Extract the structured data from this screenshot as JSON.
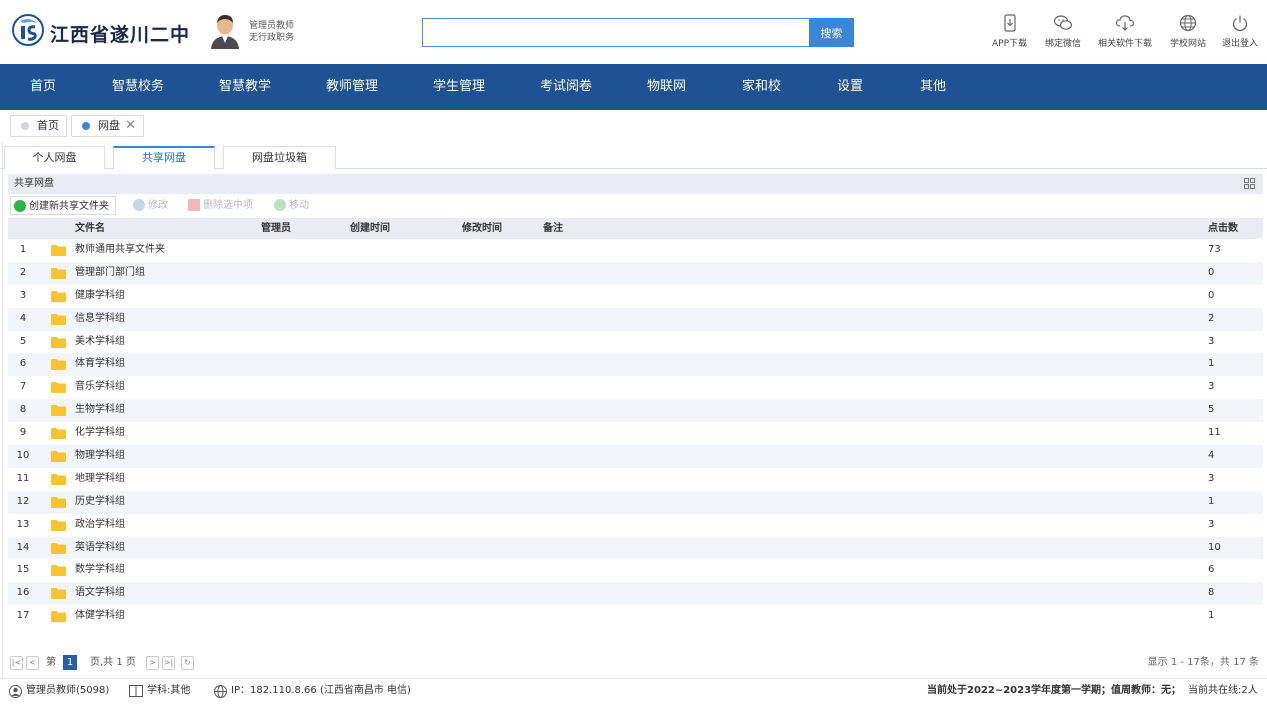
{
  "header": {
    "school_name": "江西省遂川二中",
    "user_role": "管理员教师",
    "user_dept": "无行政职务",
    "search_placeholder": "",
    "search_label": "搜索",
    "tools": [
      {
        "label": "APP下载",
        "icon": "phone-download-icon"
      },
      {
        "label": "绑定微信",
        "icon": "wechat-icon"
      },
      {
        "label": "相关软件下载",
        "icon": "cloud-download-icon"
      },
      {
        "label": "学校网站",
        "icon": "globe-icon"
      },
      {
        "label": "退出登入",
        "icon": "power-icon"
      }
    ]
  },
  "nav": {
    "items": [
      "首页",
      "智慧校务",
      "智慧教学",
      "教师管理",
      "学生管理",
      "考试阅卷",
      "物联网",
      "家和校",
      "设置",
      "其他"
    ]
  },
  "page_tabs": [
    {
      "label": "首页",
      "active": false
    },
    {
      "label": "网盘",
      "active": true
    }
  ],
  "sub_tabs": [
    {
      "label": "个人网盘",
      "active": false
    },
    {
      "label": "共享网盘",
      "active": true
    },
    {
      "label": "网盘垃圾箱",
      "active": false
    }
  ],
  "panel": {
    "title": "共享网盘",
    "toolbar": {
      "create": "创建新共享文件夹",
      "edit": "修改",
      "delete": "删除选中项",
      "move": "移动"
    },
    "columns": {
      "name": "文件名",
      "admin": "管理员",
      "created": "创建时间",
      "modified": "修改时间",
      "remark": "备注",
      "clicks": "点击数"
    },
    "rows": [
      {
        "no": "1",
        "name": "教师通用共享文件夹",
        "clicks": "73"
      },
      {
        "no": "2",
        "name": "管理部门部门组",
        "clicks": "0"
      },
      {
        "no": "3",
        "name": "健康学科组",
        "clicks": "0"
      },
      {
        "no": "4",
        "name": "信息学科组",
        "clicks": "2"
      },
      {
        "no": "5",
        "name": "美术学科组",
        "clicks": "3"
      },
      {
        "no": "6",
        "name": "体育学科组",
        "clicks": "1"
      },
      {
        "no": "7",
        "name": "音乐学科组",
        "clicks": "3"
      },
      {
        "no": "8",
        "name": "生物学科组",
        "clicks": "5"
      },
      {
        "no": "9",
        "name": "化学学科组",
        "clicks": "11"
      },
      {
        "no": "10",
        "name": "物理学科组",
        "clicks": "4"
      },
      {
        "no": "11",
        "name": "地理学科组",
        "clicks": "3"
      },
      {
        "no": "12",
        "name": "历史学科组",
        "clicks": "1"
      },
      {
        "no": "13",
        "name": "政治学科组",
        "clicks": "3"
      },
      {
        "no": "14",
        "name": "英语学科组",
        "clicks": "10"
      },
      {
        "no": "15",
        "name": "数学学科组",
        "clicks": "6"
      },
      {
        "no": "16",
        "name": "语文学科组",
        "clicks": "8"
      },
      {
        "no": "17",
        "name": "体健学科组",
        "clicks": "1"
      }
    ]
  },
  "pager": {
    "prefix": "第",
    "current": "1",
    "suffix": "页,共 1 页",
    "summary": "显示 1 - 17条，共 17 条"
  },
  "footer": {
    "user": "管理员教师(5098)",
    "subject": "学科:其他",
    "ip": "IP：182.110.8.66 (江西省南昌市 电信)",
    "term": "当前处于2022~2023学年度第一学期；值周教师：无；",
    "online": "当前共在线:2人"
  },
  "colors": {
    "nav_bg": "#1f5295",
    "accent": "#3d85d6",
    "folder": "#f7c334"
  }
}
